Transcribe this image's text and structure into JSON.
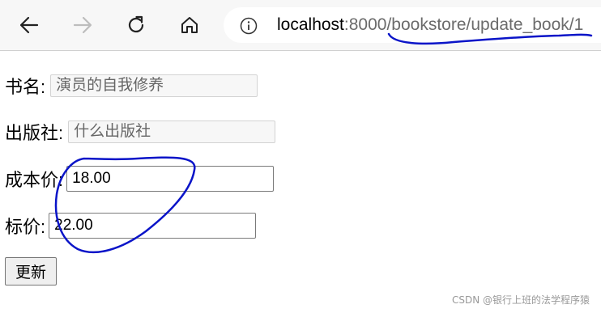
{
  "browser": {
    "url_host": "localhost",
    "url_rest": ":8000/bookstore/update_book/1",
    "icons": [
      "back-icon",
      "forward-icon",
      "reload-icon",
      "home-icon",
      "info-icon"
    ]
  },
  "form": {
    "name_label": "书名:",
    "name_value": "演员的自我修养",
    "press_label": "出版社:",
    "press_value": "什么出版社",
    "cost_label": "成本价:",
    "cost_value": "18.00",
    "price_label": "标价:",
    "price_value": "22.00",
    "submit_label": "更新"
  },
  "watermark": "CSDN @银行上班的法学程序猿",
  "colors": {
    "annotation": "#0a14c8"
  }
}
